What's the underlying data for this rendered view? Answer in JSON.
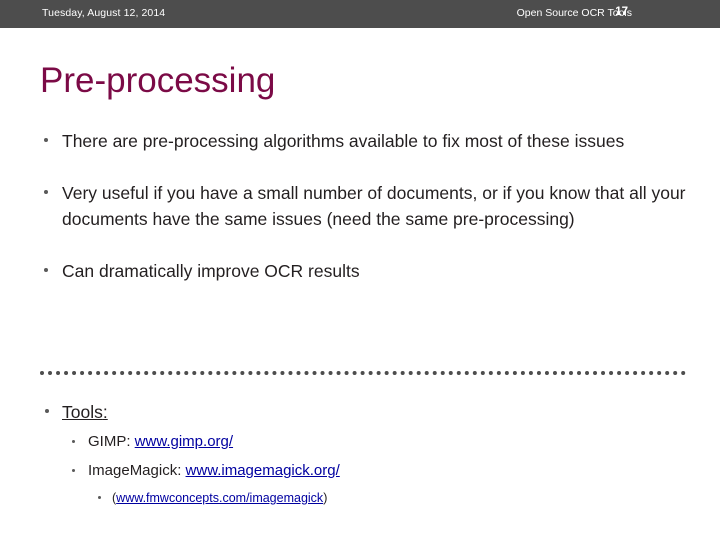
{
  "header": {
    "date": "Tuesday, August 12, 2014",
    "deck_title": "Open Source OCR Tools",
    "page_number": "17",
    "bar_color": "#4d4d4d",
    "text_color": "#ffffff"
  },
  "slide": {
    "title": "Pre-processing",
    "title_color": "#7b0a46",
    "background_color": "#ffffff",
    "body_text_color": "#231f20",
    "link_color": "#0000a0",
    "divider_color": "#4d4d4d"
  },
  "bullets": [
    {
      "text": "There are pre-processing algorithms available to fix most of these issues"
    },
    {
      "text": "Very useful if you have a small number of documents, or if you know that all your documents have the same issues (need the same pre-processing)"
    },
    {
      "text": "Can dramatically improve OCR results"
    }
  ],
  "tools": {
    "heading": "Tools",
    "heading_suffix": ":",
    "items": [
      {
        "label": "GIMP: ",
        "link_text": "www.gimp.org/"
      },
      {
        "label": "ImageMagick: ",
        "link_text": "www.imagemagick.org/ "
      }
    ],
    "subnote": {
      "open_paren": "(",
      "link_text": "www.fmwconcepts.com/imagemagick",
      "close_paren": ")"
    }
  }
}
